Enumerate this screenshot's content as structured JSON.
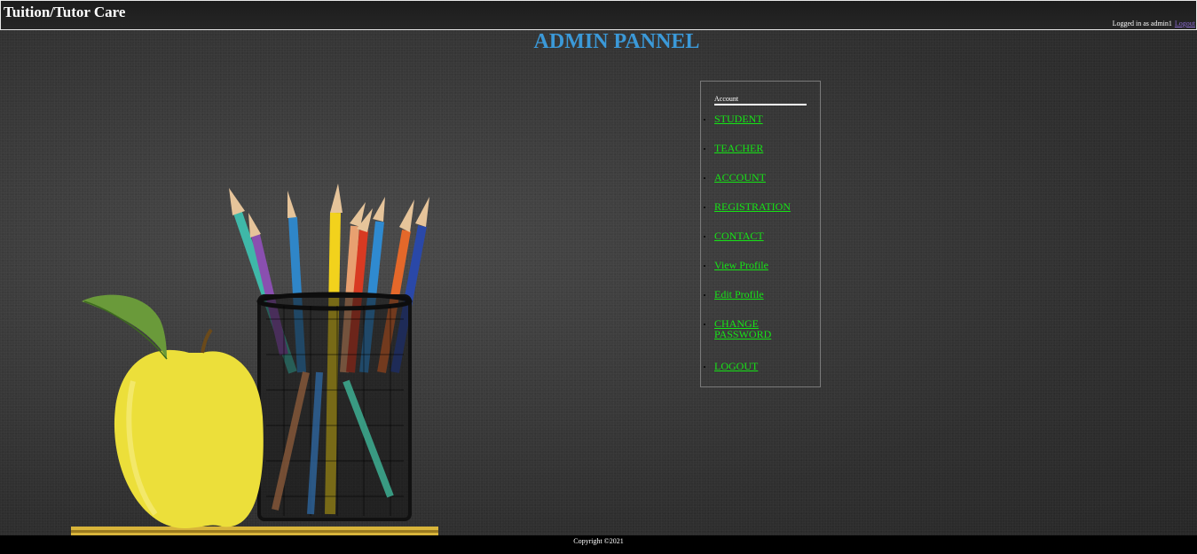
{
  "header": {
    "site_title": "Tuition/Tutor Care",
    "login_text": "Logged in as admin1",
    "logout_link": "Logout"
  },
  "main": {
    "page_title": "ADMIN PANNEL"
  },
  "menu": {
    "heading": "Account",
    "items": [
      {
        "label": "STUDENT"
      },
      {
        "label": "TEACHER"
      },
      {
        "label": "ACCOUNT"
      },
      {
        "label": "REGISTRATION"
      },
      {
        "label": "CONTACT"
      },
      {
        "label": "View Profile"
      },
      {
        "label": "Edit Profile"
      },
      {
        "label": "CHANGE PASSWORD"
      },
      {
        "label": "LOGOUT"
      }
    ]
  },
  "footer": {
    "copyright": "Copyright ©2021"
  },
  "colors": {
    "title_blue": "#3b99d8",
    "menu_link_green": "#16e516",
    "header_bg": "#1c1c1c",
    "footer_bg": "#000000"
  }
}
